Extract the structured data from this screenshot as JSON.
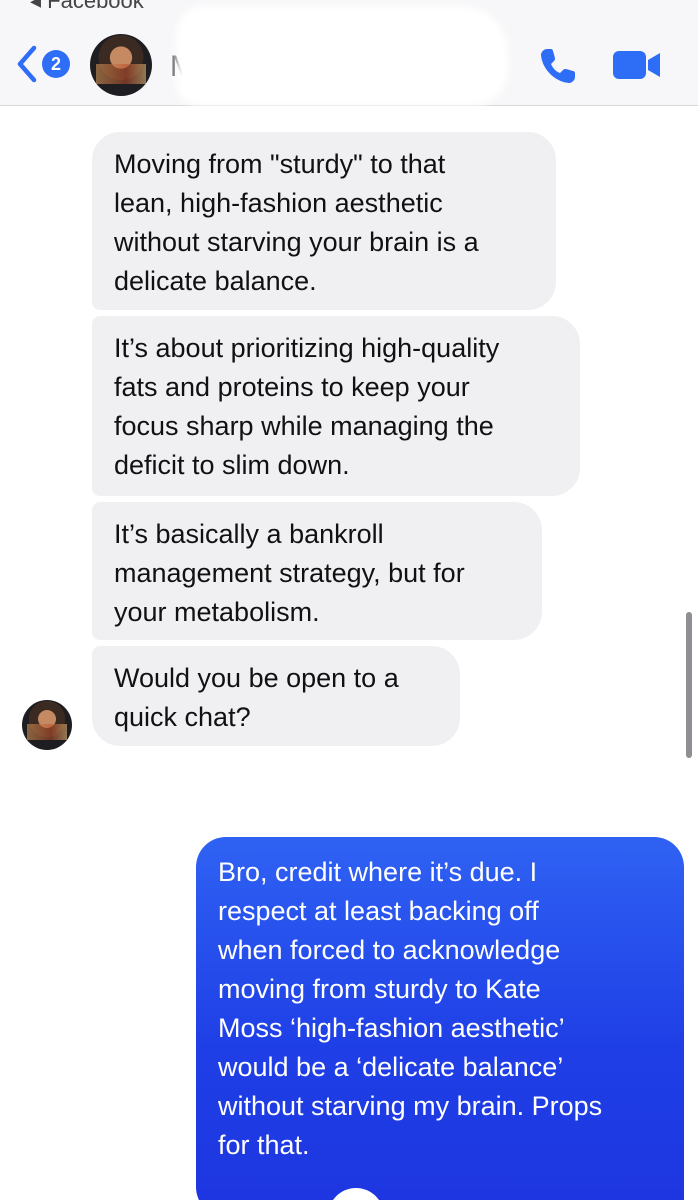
{
  "header": {
    "source_label": "◂ Facebook",
    "back_badge_count": "2",
    "contact_name": "M",
    "icons": {
      "back": "chevron-left-icon",
      "phone": "phone-icon",
      "video": "video-camera-icon"
    }
  },
  "colors": {
    "accent": "#2e6df6",
    "incoming_bubble": "#f0f0f3",
    "outgoing_bubble": "#1f3fe6"
  },
  "messages": [
    {
      "direction": "incoming",
      "lines": [
        "Moving from \"sturdy\" to that",
        "lean, high-fashion aesthetic",
        "without starving your brain is a",
        "delicate balance."
      ]
    },
    {
      "direction": "incoming",
      "lines": [
        "It’s about prioritizing high-quality",
        "fats and proteins to keep your",
        "focus sharp while managing the",
        "deficit to slim down."
      ]
    },
    {
      "direction": "incoming",
      "lines": [
        "It’s basically a bankroll",
        "management strategy, but for",
        "your metabolism."
      ]
    },
    {
      "direction": "incoming",
      "lines": [
        "Would you be open to a",
        "quick chat?"
      ]
    },
    {
      "direction": "outgoing",
      "lines": [
        "Bro, credit where it’s due. I",
        "respect at least backing off",
        "when forced to acknowledge",
        "moving from sturdy to Kate",
        "Moss ‘high-fashion aesthetic’",
        "would be a ‘delicate balance’",
        "without starving my brain. Props",
        "for that."
      ]
    }
  ]
}
